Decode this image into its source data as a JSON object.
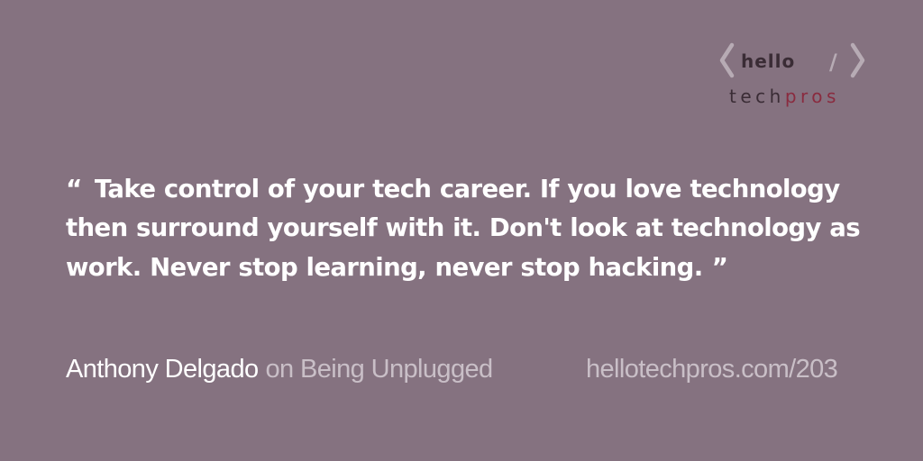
{
  "logo": {
    "word_top": "hello",
    "slash": "/",
    "word_bottom_a": "tech",
    "word_bottom_b": "pros",
    "colors": {
      "brackets": "#b7abb4",
      "dark": "#3a2c35",
      "accent": "#8a2b3f"
    }
  },
  "quote": {
    "open_mark": "“",
    "text": "Take control of your tech career. If you love technology then surround yourself with it. Don't look at technology as work. Never stop learning, never stop hacking.",
    "close_mark": "”"
  },
  "attribution": {
    "author": "Anthony Delgado",
    "episode": "on Being Unplugged"
  },
  "url": "hellotechpros.com/203",
  "colors": {
    "background": "#857280",
    "text": "#ffffff",
    "muted": "#c9bfc7"
  }
}
